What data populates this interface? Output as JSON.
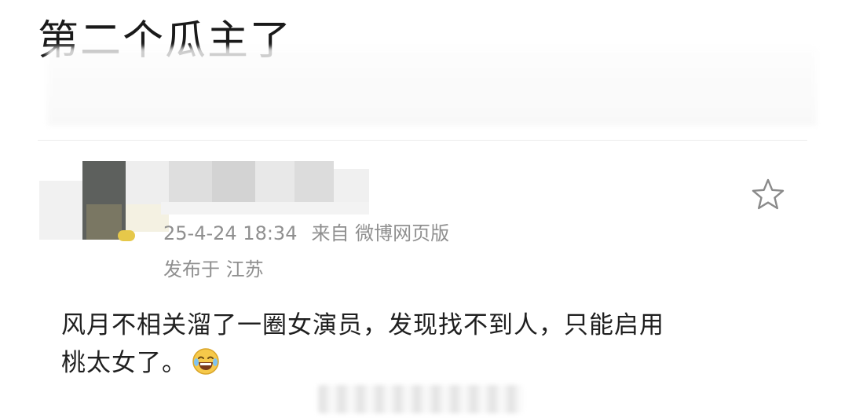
{
  "headline": "第二个瓜主了",
  "post": {
    "timestamp": "25-4-24 18:34",
    "source": "来自 微博网页版",
    "location": "发布于 江苏",
    "text_line1": "风月不相关溜了一圈女演员，发现找不到人，只能启用",
    "text_line2": "桃太女了。"
  },
  "icons": {
    "favorite": "star-outline-icon",
    "emoji": "laughing-tears-emoji-icon"
  },
  "colors": {
    "meta_text": "#8f8f8f",
    "body_text": "#1f1f1f",
    "divider": "#ececec"
  }
}
